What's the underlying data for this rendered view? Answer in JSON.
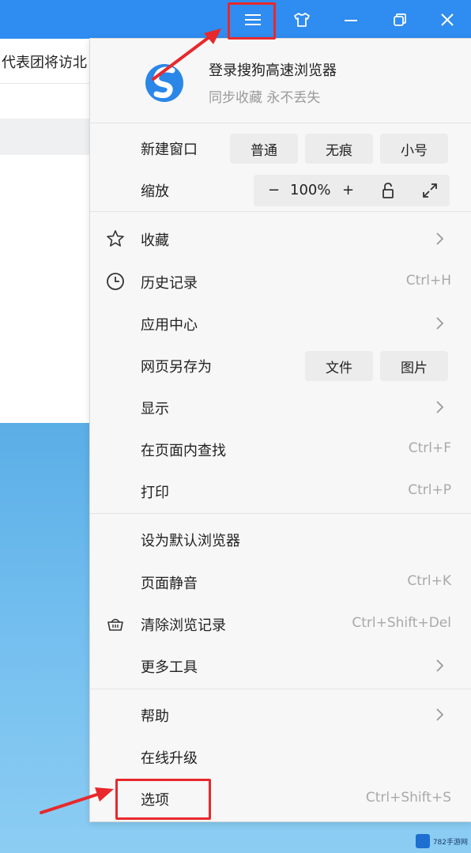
{
  "page": {
    "visible_text": "代表团将访北"
  },
  "titlebar": {
    "menu_icon": "hamburger-icon",
    "skin_icon": "shirt-icon",
    "minimize_icon": "minimize-icon",
    "restore_icon": "restore-icon",
    "close_icon": "close-icon",
    "color": "#2f8cf0"
  },
  "menu": {
    "profile": {
      "title": "登录搜狗高速浏览器",
      "subtitle": "同步收藏 永不丢失"
    },
    "new_window": {
      "label": "新建窗口",
      "options": [
        "普通",
        "无痕",
        "小号"
      ]
    },
    "zoom": {
      "label": "缩放",
      "minus": "−",
      "value": "100%",
      "plus": "+"
    },
    "items": [
      {
        "label": "收藏",
        "icon": "star-icon",
        "shortcut": "",
        "submenu": true
      },
      {
        "label": "历史记录",
        "icon": "clock-icon",
        "shortcut": "Ctrl+H",
        "submenu": false
      },
      {
        "label": "应用中心",
        "icon": "",
        "shortcut": "",
        "submenu": true
      },
      {
        "label": "网页另存为",
        "icon": "",
        "shortcut": "",
        "submenu": false,
        "options": [
          "文件",
          "图片"
        ]
      },
      {
        "label": "显示",
        "icon": "",
        "shortcut": "",
        "submenu": true
      },
      {
        "label": "在页面内查找",
        "icon": "",
        "shortcut": "Ctrl+F",
        "submenu": false
      },
      {
        "label": "打印",
        "icon": "",
        "shortcut": "Ctrl+P",
        "submenu": false
      },
      {
        "label": "设为默认浏览器",
        "icon": "",
        "shortcut": "",
        "submenu": false
      },
      {
        "label": "页面静音",
        "icon": "",
        "shortcut": "Ctrl+K",
        "submenu": false
      },
      {
        "label": "清除浏览记录",
        "icon": "basket-icon",
        "shortcut": "Ctrl+Shift+Del",
        "submenu": false
      },
      {
        "label": "更多工具",
        "icon": "",
        "shortcut": "",
        "submenu": true
      },
      {
        "label": "帮助",
        "icon": "",
        "shortcut": "",
        "submenu": true
      },
      {
        "label": "在线升级",
        "icon": "",
        "shortcut": "",
        "submenu": false
      },
      {
        "label": "选项",
        "icon": "",
        "shortcut": "Ctrl+Shift+S",
        "submenu": false
      }
    ]
  },
  "annotations": {
    "highlight_color": "#e8282b"
  }
}
